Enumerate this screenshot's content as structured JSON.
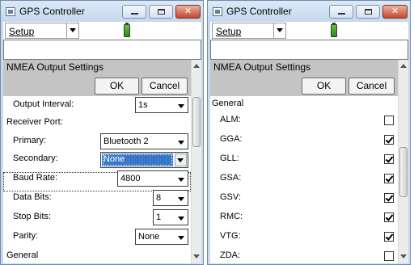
{
  "left_window": {
    "title": "GPS Controller",
    "menu": {
      "setup_label": "Setup"
    },
    "header": {
      "title": "NMEA Output Settings",
      "ok_label": "OK",
      "cancel_label": "Cancel"
    },
    "fields": {
      "output_interval": {
        "label": "Output Interval:",
        "value": "1s"
      },
      "receiver_port": {
        "label": "Receiver Port:"
      },
      "primary": {
        "label": "Primary:",
        "value": "Bluetooth 2"
      },
      "secondary": {
        "label": "Secondary:",
        "value": "None"
      },
      "baud_rate": {
        "label": "Baud Rate:",
        "value": "4800"
      },
      "data_bits": {
        "label": "Data Bits:",
        "value": "8"
      },
      "stop_bits": {
        "label": "Stop Bits:",
        "value": "1"
      },
      "parity": {
        "label": "Parity:",
        "value": "None"
      },
      "general": {
        "label": "General"
      }
    }
  },
  "right_window": {
    "title": "GPS Controller",
    "menu": {
      "setup_label": "Setup"
    },
    "header": {
      "title": "NMEA Output Settings",
      "ok_label": "OK",
      "cancel_label": "Cancel"
    },
    "section_label": "General",
    "sentences": [
      {
        "label": "ALM:",
        "checked": false
      },
      {
        "label": "GGA:",
        "checked": true
      },
      {
        "label": "GLL:",
        "checked": true
      },
      {
        "label": "GSA:",
        "checked": true
      },
      {
        "label": "GSV:",
        "checked": true
      },
      {
        "label": "RMC:",
        "checked": true
      },
      {
        "label": "VTG:",
        "checked": true
      },
      {
        "label": "ZDA:",
        "checked": false
      }
    ]
  },
  "colors": {
    "window_frame": "#c8d9ee",
    "header_gray": "#c4c4c4",
    "selection_blue": "#3b79c8",
    "battery_green": "#3aa31f"
  }
}
